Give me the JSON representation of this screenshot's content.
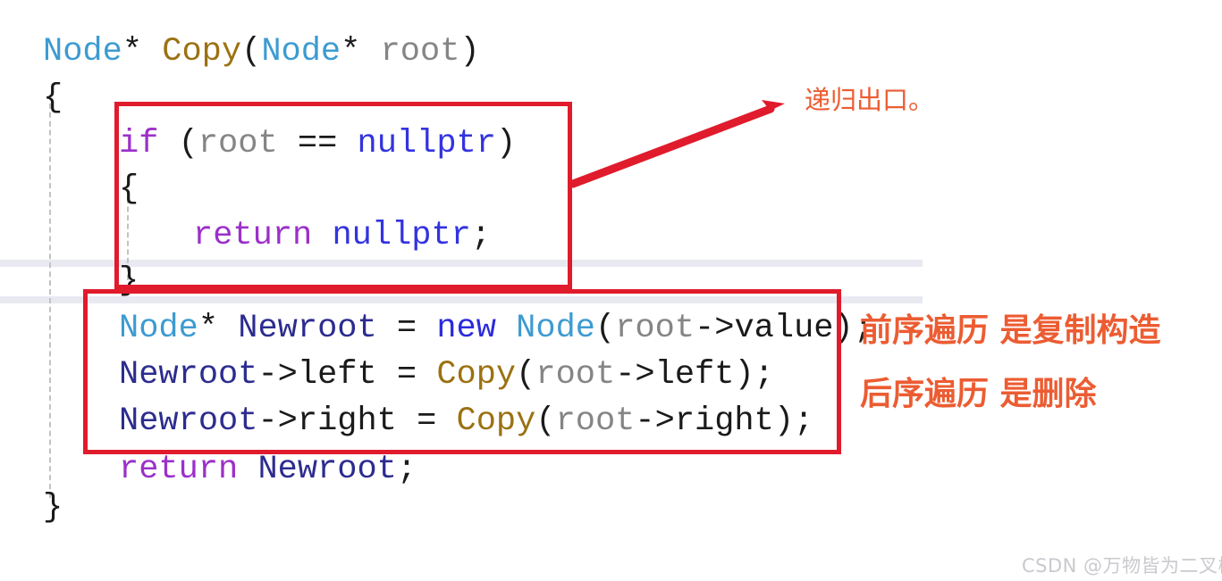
{
  "document": {
    "kind": "code-screenshot-with-annotations",
    "language": "C++",
    "background_color": "#ffffff"
  },
  "code": {
    "font_color_default": "#1a1a1a",
    "lines": [
      {
        "id": "line-1",
        "text": "Node* Copy(Node* root)",
        "tokens": [
          {
            "t": "Node",
            "cls": "tk-type"
          },
          {
            "t": "*",
            "cls": "tk-star"
          },
          {
            "t": " ",
            "cls": "tk-punct"
          },
          {
            "t": "Copy",
            "cls": "tk-func"
          },
          {
            "t": "(",
            "cls": "tk-punct"
          },
          {
            "t": "Node",
            "cls": "tk-type"
          },
          {
            "t": "*",
            "cls": "tk-star"
          },
          {
            "t": " ",
            "cls": "tk-punct"
          },
          {
            "t": "root",
            "cls": "tk-param"
          },
          {
            "t": ")",
            "cls": "tk-punct"
          }
        ]
      },
      {
        "id": "line-2",
        "text": "{",
        "tokens": [
          {
            "t": "{",
            "cls": "tk-brace"
          }
        ]
      },
      {
        "id": "line-3",
        "text": "if (root == nullptr)",
        "tokens": [
          {
            "t": "if",
            "cls": "tk-kw"
          },
          {
            "t": " (",
            "cls": "tk-punct"
          },
          {
            "t": "root",
            "cls": "tk-param"
          },
          {
            "t": " == ",
            "cls": "tk-op"
          },
          {
            "t": "nullptr",
            "cls": "tk-null"
          },
          {
            "t": ")",
            "cls": "tk-punct"
          }
        ]
      },
      {
        "id": "line-4",
        "text": "{",
        "tokens": [
          {
            "t": "{",
            "cls": "tk-brace"
          }
        ]
      },
      {
        "id": "line-5",
        "text": "return nullptr;",
        "tokens": [
          {
            "t": "return",
            "cls": "tk-kw"
          },
          {
            "t": " ",
            "cls": "tk-punct"
          },
          {
            "t": "nullptr",
            "cls": "tk-null"
          },
          {
            "t": ";",
            "cls": "tk-punct"
          }
        ]
      },
      {
        "id": "line-6",
        "text": "}",
        "tokens": [
          {
            "t": "}",
            "cls": "tk-brace"
          }
        ]
      },
      {
        "id": "line-7",
        "text": "Node* Newroot = new Node(root->value);",
        "tokens": [
          {
            "t": "Node",
            "cls": "tk-type"
          },
          {
            "t": "*",
            "cls": "tk-star"
          },
          {
            "t": " ",
            "cls": "tk-punct"
          },
          {
            "t": "Newroot",
            "cls": "tk-var"
          },
          {
            "t": " = ",
            "cls": "tk-op"
          },
          {
            "t": "new",
            "cls": "tk-kw2"
          },
          {
            "t": " ",
            "cls": "tk-punct"
          },
          {
            "t": "Node",
            "cls": "tk-type"
          },
          {
            "t": "(",
            "cls": "tk-punct"
          },
          {
            "t": "root",
            "cls": "tk-param"
          },
          {
            "t": "->",
            "cls": "tk-op"
          },
          {
            "t": "value",
            "cls": "tk-punct"
          },
          {
            "t": ");",
            "cls": "tk-punct"
          }
        ]
      },
      {
        "id": "line-8",
        "text": "Newroot->left = Copy(root->left);",
        "tokens": [
          {
            "t": "Newroot",
            "cls": "tk-var"
          },
          {
            "t": "->",
            "cls": "tk-op"
          },
          {
            "t": "left",
            "cls": "tk-punct"
          },
          {
            "t": " = ",
            "cls": "tk-op"
          },
          {
            "t": "Copy",
            "cls": "tk-func"
          },
          {
            "t": "(",
            "cls": "tk-punct"
          },
          {
            "t": "root",
            "cls": "tk-param"
          },
          {
            "t": "->",
            "cls": "tk-op"
          },
          {
            "t": "left",
            "cls": "tk-punct"
          },
          {
            "t": ");",
            "cls": "tk-punct"
          }
        ]
      },
      {
        "id": "line-9",
        "text": "Newroot->right = Copy(root->right);",
        "tokens": [
          {
            "t": "Newroot",
            "cls": "tk-var"
          },
          {
            "t": "->",
            "cls": "tk-op"
          },
          {
            "t": "right",
            "cls": "tk-punct"
          },
          {
            "t": " = ",
            "cls": "tk-op"
          },
          {
            "t": "Copy",
            "cls": "tk-func"
          },
          {
            "t": "(",
            "cls": "tk-punct"
          },
          {
            "t": "root",
            "cls": "tk-param"
          },
          {
            "t": "->",
            "cls": "tk-op"
          },
          {
            "t": "right",
            "cls": "tk-punct"
          },
          {
            "t": ");",
            "cls": "tk-punct"
          }
        ]
      },
      {
        "id": "line-10",
        "text": "return Newroot;",
        "tokens": [
          {
            "t": "return",
            "cls": "tk-kw"
          },
          {
            "t": " ",
            "cls": "tk-punct"
          },
          {
            "t": "Newroot",
            "cls": "tk-var"
          },
          {
            "t": ";",
            "cls": "tk-punct"
          }
        ]
      },
      {
        "id": "line-11",
        "text": "}",
        "tokens": [
          {
            "t": "}",
            "cls": "tk-brace"
          }
        ]
      }
    ]
  },
  "annotations": {
    "accent_color": "#e01b2c",
    "text_color": "#ec5c32",
    "recursion_exit_note": "递归出口。",
    "preorder_note": "前序遍历 是复制构造",
    "postorder_note": "后序遍历 是删除",
    "box_labels": {
      "base_case_box": "if-nullptr base case box",
      "recursive_box": "preorder recursive copy box"
    }
  },
  "editor": {
    "highlight_bar_color": "#e9e9f2",
    "indent_guide_color": "#c2c2c2"
  },
  "watermark": {
    "text": "CSDN @万物皆为二叉树",
    "color": "#c9c9cf"
  }
}
